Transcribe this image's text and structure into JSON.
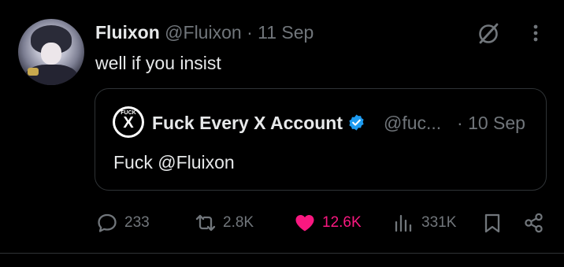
{
  "tweet": {
    "display_name": "Fluixon",
    "handle": "@Fluixon",
    "separator": "·",
    "date": "11 Sep",
    "text": "well if you insist"
  },
  "quote": {
    "display_name": "Fuck Every X Account",
    "handle": "@fuc...",
    "separator": "·",
    "date": "10 Sep",
    "text": "Fuck @Fluixon",
    "avatar_text_top": "FUCK",
    "avatar_text_main": "X"
  },
  "actions": {
    "replies": "233",
    "reposts": "2.8K",
    "likes": "12.6K",
    "views": "331K"
  },
  "colors": {
    "background": "#000000",
    "text": "#e7e9ea",
    "muted": "#71767b",
    "like": "#f91880",
    "verified": "#1d9bf0",
    "border": "#2f3336"
  },
  "icons": [
    "grok-icon",
    "more-icon",
    "verified-badge-icon",
    "reply-icon",
    "repost-icon",
    "like-icon",
    "views-icon",
    "bookmark-icon",
    "share-icon"
  ]
}
